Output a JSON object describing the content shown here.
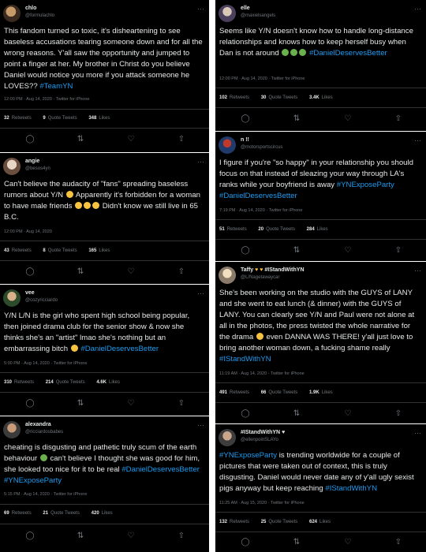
{
  "tweets": [
    {
      "name": "chlo",
      "handle": "@formulachlo",
      "text": "This fandom turned so toxic, it's disheartening to see baseless accusations tearing someone down and for all the wrong reasons. Y'all saw the opportunity and jumped to point a finger at her. My brother in Christ do you believe Daniel would notice you more if you attack someone he LOVES??",
      "hashtags": "#TeamYN",
      "meta": "12:00 PM · Aug 14, 2020 · Twitter for iPhone",
      "retweets": "32",
      "quotes": "9",
      "likes": "348"
    },
    {
      "name": "angie",
      "handle": "@besos4yn",
      "text": "Can't believe the audacity of \"fans\" spreading baseless rumors about Y/N",
      "text2": "Apparently it's forbidden for a woman to have male friends",
      "text3": "Didn't know we still live in 65 B.C.",
      "meta": "12:00 PM · Aug 14, 2020",
      "retweets": "43",
      "quotes": "8",
      "likes": "165"
    },
    {
      "name": "vee",
      "handle": "@cozyricciardo",
      "text": "Y/N L/N is the girl who spent high school being popular, then joined drama club for the senior show & now she thinks she's an \"artist\" lmao she's nothing but an embarrassing bitch",
      "hashtags": "#DanielDeservesBetter",
      "meta": "5:00 PM · Aug 14, 2020 · Twitter for iPhone",
      "retweets": "310",
      "quotes": "214",
      "likes": "4.6K"
    },
    {
      "name": "alexandra",
      "handle": "@ricciardosbabes",
      "text": "cheating is disgusting and pathetic truly scum of the earth behaviour",
      "text2": "can't believe I thought she was good for him, she looked too nice for it to be real",
      "hashtags": "#DanielDeservesBetter #YNExposeParty",
      "meta": "5:15 PM · Aug 14, 2020 · Twitter for iPhone",
      "retweets": "69",
      "quotes": "21",
      "likes": "420"
    },
    {
      "name": "elle",
      "handle": "@maxielsangels",
      "text": "Seems like Y/N doesn't know how to handle long-distance relationships and knows how to keep herself busy when Dan is not around",
      "hashtags": "#DanielDeservesBetter",
      "meta": "12:00 PM · Aug 14, 2020 · Twitter for iPhone",
      "retweets": "102",
      "quotes": "30",
      "likes": "3.4K"
    },
    {
      "name": "n !!",
      "handle": "@motorsportscircus",
      "text": "I figure if you're \"so happy\" in your relationship you should focus on that instead of sleazing your way through LA's ranks while your boyfriend is away",
      "hashtags": "#YNExposeParty #DanielDeservesBetter",
      "meta": "7:19 PM · Aug 14, 2020 · Twitter for iPhone",
      "retweets": "51",
      "quotes": "20",
      "likes": "284"
    },
    {
      "name": "Taffy",
      "name_tag": "#IStandWithYN",
      "handle": "@L/Nagetawaycar",
      "text": "She's been working on the studio with the GUYS of LANY and she went to eat lunch (& dinner) with the GUYS of LANY. You can clearly see Y/N and Paul were not alone at all in the photos, the press twisted the whole narrative for the drama",
      "text2": "even DANNA WAS THERE! y'all just love to bring another woman down, a fucking shame really",
      "hashtags": "#IStandWithYN",
      "meta": "11:19 AM · Aug 14, 2020 · Twitter for iPhone",
      "retweets": "491",
      "quotes": "66",
      "likes": "1.9K"
    },
    {
      "name": "#IStandWithYN",
      "handle": "@ellenpoinSLAYo",
      "hashtags_lead": "#YNExposeParty",
      "text": "is trending worldwide for a couple of pictures that were taken out of context, this is truly disgusting. Daniel would never date any of y'all ugly sexist pigs anyway but keep reaching",
      "hashtags": "#IStandWithYN",
      "meta": "11:25 AM · Aug 15, 2020 · Twitter for iPhone",
      "retweets": "132",
      "quotes": "25",
      "likes": "624"
    }
  ],
  "labels": {
    "retweets": "Retweets",
    "quotes": "Quote Tweets",
    "likes": "Likes"
  },
  "icons": {
    "reply": "reply-icon",
    "retweet": "retweet-icon",
    "like": "heart-icon",
    "share": "share-icon",
    "more": "more-icon"
  },
  "colors": {
    "background": "#000000",
    "text": "#e7e9ea",
    "muted": "#71767b",
    "hashtag": "#1d9bf0",
    "divider": "#2f3336"
  }
}
